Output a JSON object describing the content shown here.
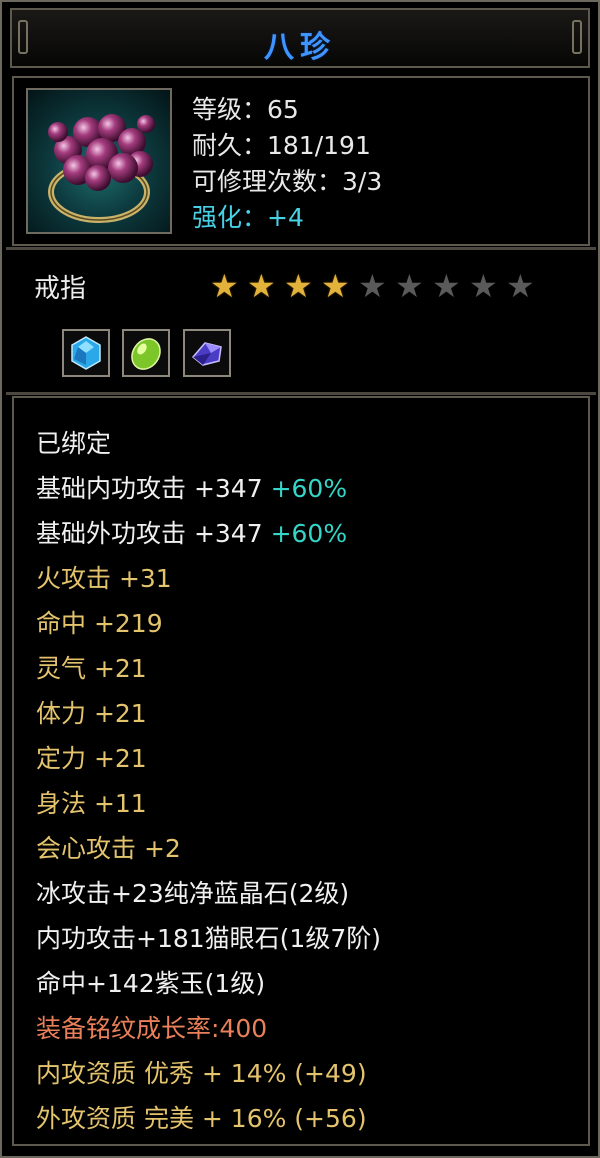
{
  "title": "八珍",
  "item": {
    "icon": "ring-amethyst-icon",
    "stats": {
      "level": "等级：65",
      "durability": "耐久：181/191",
      "repairs": "可修理次数：3/3",
      "enhance": "强化：+4"
    },
    "type": "戒指",
    "stars_filled": 4,
    "stars_total": 9,
    "gems": [
      "blue-gem-icon",
      "green-gem-icon",
      "purple-gem-icon"
    ]
  },
  "attributes": {
    "bound": "已绑定",
    "inner_attack": "基础内功攻击 +347",
    "inner_attack_pct": "+60%",
    "outer_attack": "基础外功攻击 +347",
    "outer_attack_pct": "+60%",
    "fire": "火攻击 +31",
    "hit": "命中 +219",
    "spirit": "灵气 +21",
    "stamina": "体力 +21",
    "focus": "定力 +21",
    "agility": "身法 +11",
    "crit": "会心攻击 +2",
    "gem1": "冰攻击+23纯净蓝晶石(2级)",
    "gem2": "内功攻击+181猫眼石(1级7阶)",
    "gem3": "命中+142紫玉(1级)",
    "growth": "装备铭纹成长率:400",
    "inner_quality": "内攻资质 优秀 + 14% (+49)",
    "outer_quality": "外攻资质 完美 + 16% (+56)"
  },
  "colors": {
    "title": "#3f95ff",
    "cyan": "#47d1e6",
    "gold": "#e4c36d",
    "orange": "#e9805a",
    "teal": "#35d5c8"
  }
}
